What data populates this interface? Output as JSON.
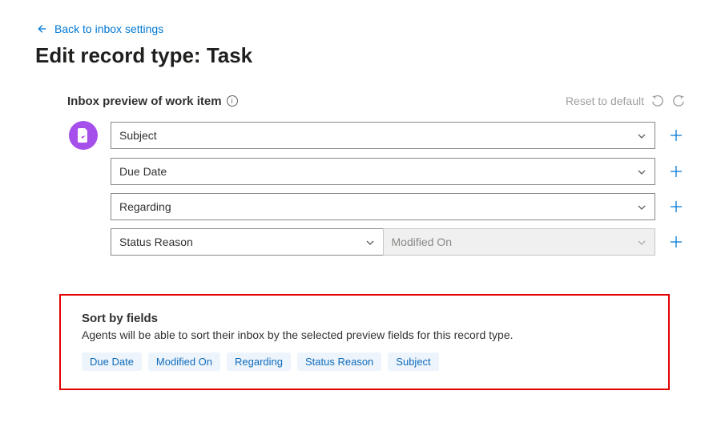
{
  "back_link": "Back to inbox settings",
  "page_title": "Edit record type: Task",
  "preview": {
    "label": "Inbox preview of work item",
    "reset_label": "Reset to default",
    "rows": [
      {
        "field": "Subject",
        "secondary": null
      },
      {
        "field": "Due Date",
        "secondary": null
      },
      {
        "field": "Regarding",
        "secondary": null
      },
      {
        "field": "Status Reason",
        "secondary": "Modified On"
      }
    ]
  },
  "sort": {
    "title": "Sort by fields",
    "description": "Agents will be able to sort their inbox by the selected preview fields for this record type.",
    "chips": [
      "Due Date",
      "Modified On",
      "Regarding",
      "Status Reason",
      "Subject"
    ]
  }
}
